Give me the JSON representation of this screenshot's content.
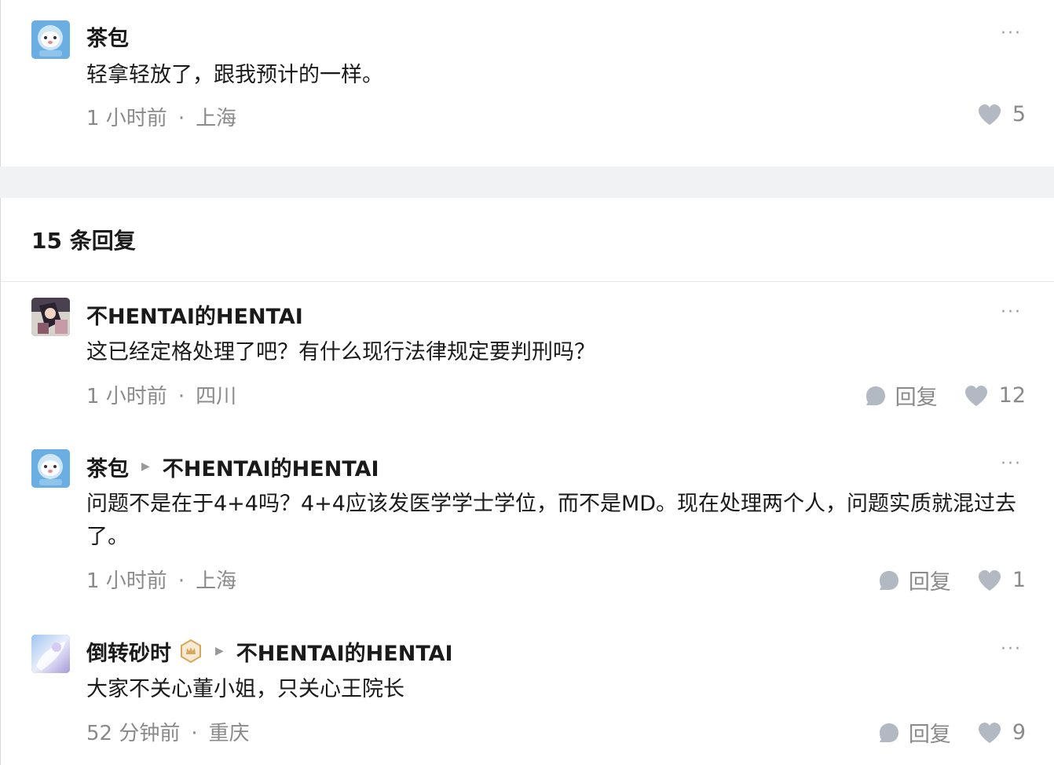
{
  "top_comment": {
    "author": "茶包",
    "text": "轻拿轻放了，跟我预计的一样。",
    "time": "1 小时前",
    "location": "上海",
    "likes": "5"
  },
  "replies_header": "15 条回复",
  "replies": [
    {
      "author": "不HENTAI的HENTAI",
      "text": "这已经定格处理了吧？有什么现行法律规定要判刑吗？",
      "time": "1 小时前",
      "location": "四川",
      "reply_label": "回复",
      "likes": "12"
    },
    {
      "author": "茶包",
      "reply_to": "不HENTAI的HENTAI",
      "text": "问题不是在于4+4吗？4+4应该发医学学士学位，而不是MD。现在处理两个人，问题实质就混过去了。",
      "time": "1 小时前",
      "location": "上海",
      "reply_label": "回复",
      "likes": "1"
    },
    {
      "author": "倒转砂时",
      "reply_to": "不HENTAI的HENTAI",
      "text": "大家不关心董小姐，只关心王院长",
      "time": "52 分钟前",
      "location": "重庆",
      "reply_label": "回复",
      "likes": "9"
    }
  ],
  "icons": {
    "more": "more-icon",
    "heart": "heart-icon",
    "reply_bubble": "comment-bubble-icon",
    "reply_arrow": "triangle-right-icon",
    "badge": "crown-badge-icon"
  },
  "colors": {
    "text": "#1a1a1a",
    "muted": "#8a8a8a",
    "icon": "#b3b9c2",
    "band": "#f1f2f4",
    "badge": "#d9a75a"
  }
}
